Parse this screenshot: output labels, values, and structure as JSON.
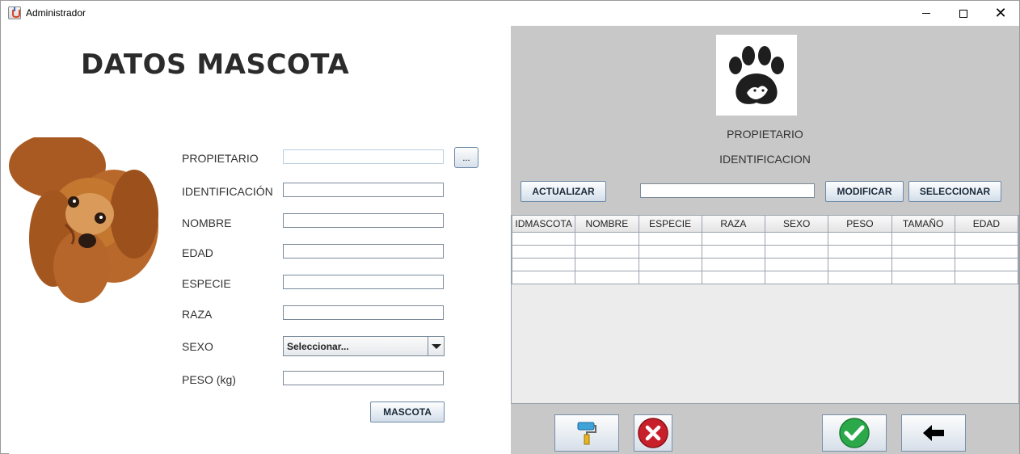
{
  "window": {
    "title": "Administrador"
  },
  "form": {
    "heading": "DATOS MASCOTA",
    "labels": {
      "propietario": "PROPIETARIO",
      "identificacion": "IDENTIFICACIÓN",
      "nombre": "NOMBRE",
      "edad": "EDAD",
      "especie": "ESPECIE",
      "raza": "RAZA",
      "sexo": "SEXO",
      "peso": "PESO (kg)"
    },
    "values": {
      "propietario": "",
      "identificacion": "",
      "nombre": "",
      "edad": "",
      "especie": "",
      "raza": "",
      "peso": ""
    },
    "browse_button": "...",
    "sexo_select": "Seleccionar...",
    "submit_button": "MASCOTA"
  },
  "right": {
    "owner_label": "PROPIETARIO",
    "id_label": "IDENTIFICACION",
    "buttons": {
      "actualizar": "ACTUALIZAR",
      "modificar": "MODIFICAR",
      "seleccionar": "SELECCIONAR"
    },
    "search_value": "",
    "table": {
      "columns": [
        "IDMASCOTA",
        "NOMBRE",
        "ESPECIE",
        "RAZA",
        "SEXO",
        "PESO",
        "TAMAÑO",
        "EDAD"
      ],
      "rows": [
        [
          "",
          "",
          "",
          "",
          "",
          "",
          "",
          ""
        ],
        [
          "",
          "",
          "",
          "",
          "",
          "",
          "",
          ""
        ],
        [
          "",
          "",
          "",
          "",
          "",
          "",
          "",
          ""
        ],
        [
          "",
          "",
          "",
          "",
          "",
          "",
          "",
          ""
        ]
      ]
    },
    "action_icons": [
      "paint-roller-icon",
      "cancel-icon",
      "confirm-check-icon",
      "back-arrow-icon"
    ]
  },
  "colors": {
    "right_panel_bg": "#c8c8c8",
    "cancel_red": "#c8202a",
    "confirm_green": "#2aa84a"
  }
}
